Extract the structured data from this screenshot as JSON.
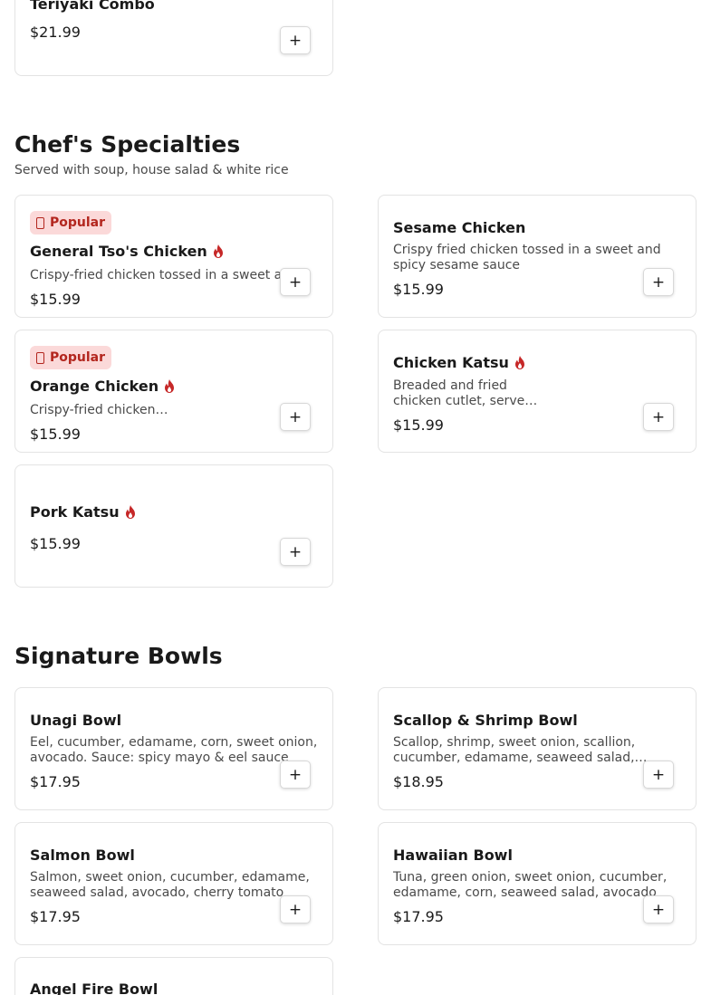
{
  "teriyaki": {
    "title": "Teriyaki Combo",
    "price": "$21.99",
    "add": "+"
  },
  "chefs": {
    "title": "Chef's Specialties",
    "subtitle": "Served with soup, house salad & white rice",
    "items": [
      {
        "badge": "Popular",
        "title": "General Tso's Chicken",
        "spicy": true,
        "desc": "Crispy-fried chicken tossed in a sweet a",
        "price": "$15.99",
        "add": "+"
      },
      {
        "title": "Sesame Chicken",
        "desc": "Crispy fried chicken tossed in a sweet and spicy sesame sauce",
        "price": "$15.99",
        "add": "+"
      },
      {
        "badge": "Popular",
        "title": "Orange Chicken",
        "spicy": true,
        "desc": "Crispy-fried chicken…",
        "price": "$15.99",
        "add": "+"
      },
      {
        "title": "Chicken Katsu",
        "spicy": true,
        "desc": "Breaded and fried chicken cutlet, serve…",
        "price": "$15.99",
        "add": "+"
      },
      {
        "title": "Pork Katsu",
        "spicy": true,
        "price": "$15.99",
        "add": "+"
      }
    ]
  },
  "bowls": {
    "title": "Signature Bowls",
    "items": [
      {
        "title": "Unagi Bowl",
        "desc": "Eel, cucumber, edamame, corn, sweet onion, avocado. Sauce: spicy mayo & eel sauce",
        "price": "$17.95",
        "add": "+"
      },
      {
        "title": "Scallop & Shrimp Bowl",
        "desc": "Scallop, shrimp, sweet onion, scallion, cucumber, edamame, seaweed salad,…",
        "price": "$18.95",
        "add": "+"
      },
      {
        "title": "Salmon Bowl",
        "desc": "Salmon, sweet onion, cucumber, edamame, seaweed salad, avocado, cherry tomato",
        "price": "$17.95",
        "add": "+"
      },
      {
        "title": "Hawaiian Bowl",
        "desc": "Tuna, green onion, sweet onion, cucumber, edamame, corn, seaweed salad, avocado",
        "price": "$17.95",
        "add": "+"
      },
      {
        "title": "Angel Fire Bowl"
      }
    ]
  },
  "icons": {
    "spicy": "flame-icon",
    "popular": "popular-icon"
  },
  "colors": {
    "accent": "#b3261e",
    "badge_bg": "#fbd9d9",
    "flame": "#c62828"
  }
}
